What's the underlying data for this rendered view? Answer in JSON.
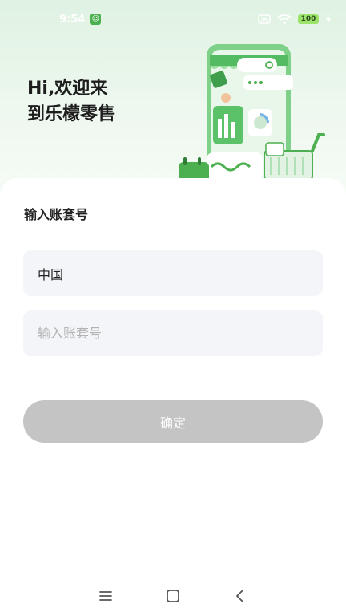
{
  "status_bar": {
    "time": "9:54",
    "battery": "100"
  },
  "hero": {
    "greeting_line1": "Hi,欢迎来",
    "greeting_line2": "到乐檬零售"
  },
  "form": {
    "title": "输入账套号",
    "country_value": "中国",
    "account_placeholder": "输入账套号",
    "account_value": "",
    "confirm_label": "确定"
  },
  "colors": {
    "accent_green": "#4caf50",
    "button_disabled": "#c4c4c4",
    "field_bg": "#f3f5f8"
  },
  "icons": {
    "nav_menu": "menu-icon",
    "nav_home": "home-square-icon",
    "nav_back": "back-chevron-icon"
  }
}
